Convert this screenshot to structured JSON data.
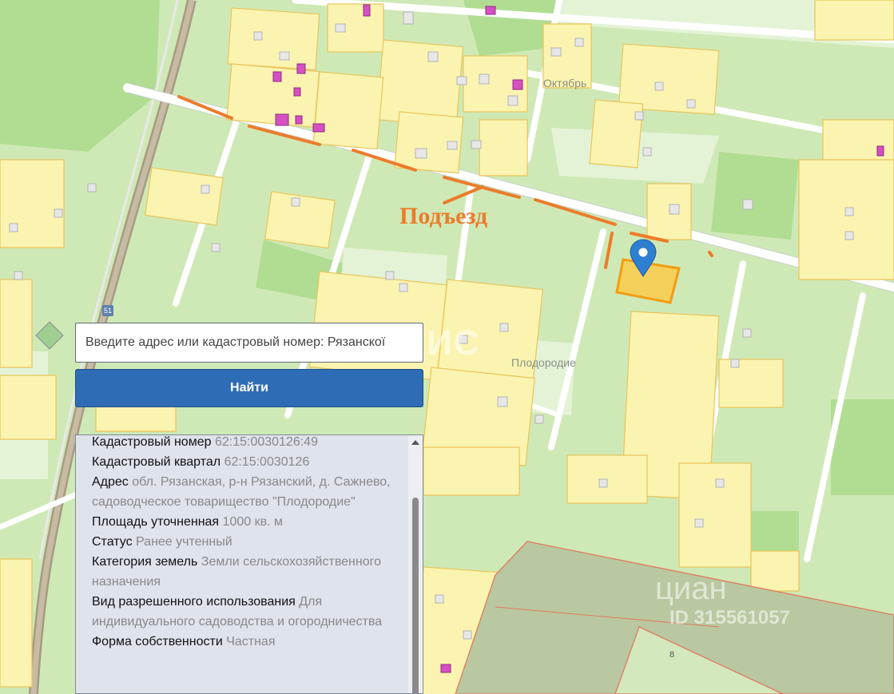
{
  "search": {
    "placeholder": "Введите адрес или кадастровый номер: Рязанскої",
    "button_label": "Найти"
  },
  "annotation": {
    "label": "Подъезд",
    "color": "#ec7c2b"
  },
  "map": {
    "labels": [
      "Октябрь",
      "Плодородие",
      "8"
    ],
    "badge": "51",
    "watermarks": [
      "ВЛАДИС",
      "циан",
      "ID 315561057"
    ],
    "colors": {
      "background": "#cfe9b6",
      "plot_fill": "#fbf4b0",
      "plot_border": "#e9c45a",
      "road": "#ffffff",
      "selected_plot": "#f39c12",
      "marker": "#2f7fd1"
    }
  },
  "info": {
    "rows": [
      {
        "label": "Кадастровый номер",
        "value": "62:15:0030126:49"
      },
      {
        "label": "Кадастровый квартал",
        "value": "62:15:0030126"
      },
      {
        "label": "Адрес",
        "value": "обл. Рязанская, р-н Рязанский, д. Сажнево, садоводческое товарищество \"Плодородие\""
      },
      {
        "label": "Площадь уточненная",
        "value": "1000 кв. м"
      },
      {
        "label": "Статус",
        "value": "Ранее учтенный"
      },
      {
        "label": "Категория земель",
        "value": "Земли сельскохозяйственного назначения"
      },
      {
        "label": "Вид разрешенного использования",
        "value": "Для индивидуального садоводства и огородничества"
      },
      {
        "label": "Форма собственности",
        "value": "Частная"
      }
    ]
  }
}
